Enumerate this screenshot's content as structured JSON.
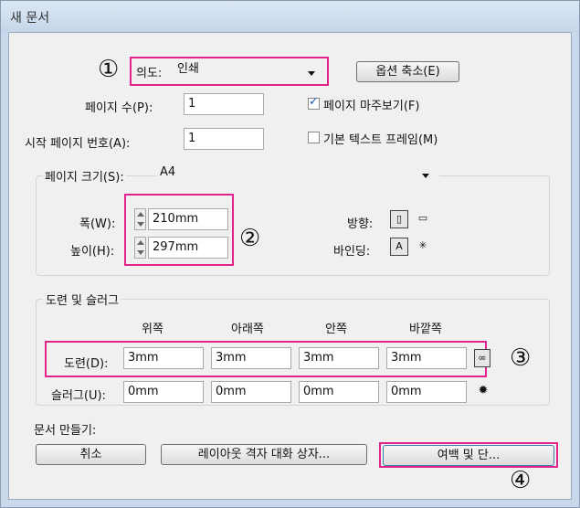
{
  "window": {
    "title": "새 문서"
  },
  "intent": {
    "label": "의도:",
    "value": "인쇄",
    "marker": "①"
  },
  "fewer_options_label": "옵션 축소(E)",
  "pages_label": "페이지 수(P):",
  "pages_value": "1",
  "facing_pages_label": "페이지 마주보기(F)",
  "facing_pages_checked": true,
  "start_page_label": "시작 페이지 번호(A):",
  "start_page_value": "1",
  "master_text_label": "기본 텍스트 프레임(M)",
  "master_text_checked": false,
  "page_size": {
    "label": "페이지 크기(S):",
    "value": "A4",
    "width_label": "폭(W):",
    "width_value": "210mm",
    "height_label": "높이(H):",
    "height_value": "297mm",
    "marker": "②",
    "orientation_label": "방향:",
    "binding_label": "바인딩:"
  },
  "bleed_slug": {
    "title": "도련 및 슬러그",
    "columns": [
      "위쪽",
      "아래쪽",
      "안쪽",
      "바깥쪽"
    ],
    "bleed_label": "도련(D):",
    "bleed_values": [
      "3mm",
      "3mm",
      "3mm",
      "3mm"
    ],
    "slug_label": "슬러그(U):",
    "slug_values": [
      "0mm",
      "0mm",
      "0mm",
      "0mm"
    ],
    "marker": "③"
  },
  "create_label": "문서 만들기:",
  "cancel_label": "취소",
  "layout_grid_label": "레이아웃 격자 대화 상자...",
  "margins_columns_label": "여백 및 단...",
  "margins_marker": "④",
  "accent_color": "#e0228a"
}
